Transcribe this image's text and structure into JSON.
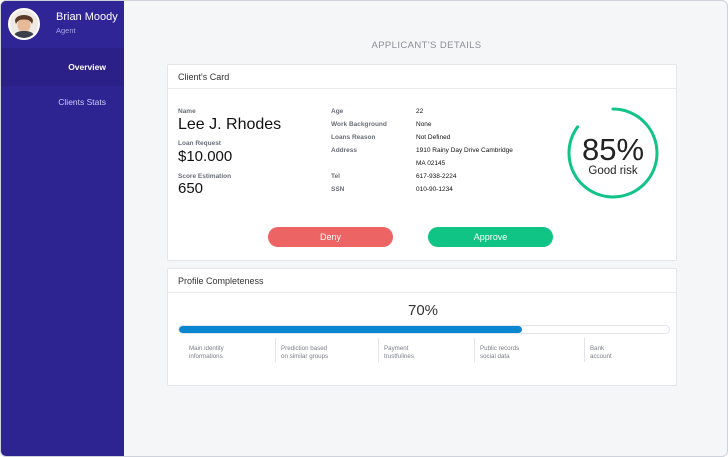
{
  "sidebar": {
    "user_name": "Brian Moody",
    "user_role": "Agent",
    "nav": [
      {
        "label": "Overview"
      },
      {
        "label": "Clients  Stats"
      }
    ]
  },
  "main": {
    "title": "APPLICANT'S DETAILS",
    "client_card": {
      "header": "Client's Card",
      "name_label": "Name",
      "name": "Lee J. Rhodes",
      "loan_label": "Loan Request",
      "loan": "$10.000",
      "score_label": "Score Estimation",
      "score": "650",
      "details": [
        {
          "label": "Age",
          "value": "22"
        },
        {
          "label": "Work Background",
          "value": "None"
        },
        {
          "label": "Loans Reason",
          "value": "Not Defined"
        },
        {
          "label": "Address",
          "value": "1910 Rainy Day Drive Cambridge"
        },
        {
          "label": "",
          "value": "MA 02145"
        },
        {
          "label": "Tel",
          "value": "617-938-2224"
        },
        {
          "label": "SSN",
          "value": "010-90-1234"
        }
      ],
      "gauge": {
        "percent": "85%",
        "value": 0.85,
        "caption": "Good risk",
        "color": "#10c486"
      },
      "deny_label": "Deny",
      "approve_label": "Approve"
    },
    "profile_card": {
      "header": "Profile Completeness",
      "percent_label": "70%",
      "progress": 0.7,
      "steps": [
        {
          "line1": "Main identity",
          "line2": "informations"
        },
        {
          "line1": "Prediction based",
          "line2": "on similar groups"
        },
        {
          "line1": "Payment",
          "line2": "trustfulines"
        },
        {
          "line1": "Public records",
          "line2": "social data"
        },
        {
          "line1": "Bank",
          "line2": "account"
        }
      ]
    }
  },
  "colors": {
    "sidebar": "#2d2391",
    "deny": "#ec6463",
    "approve": "#10c486",
    "progress": "#0a86d0"
  }
}
